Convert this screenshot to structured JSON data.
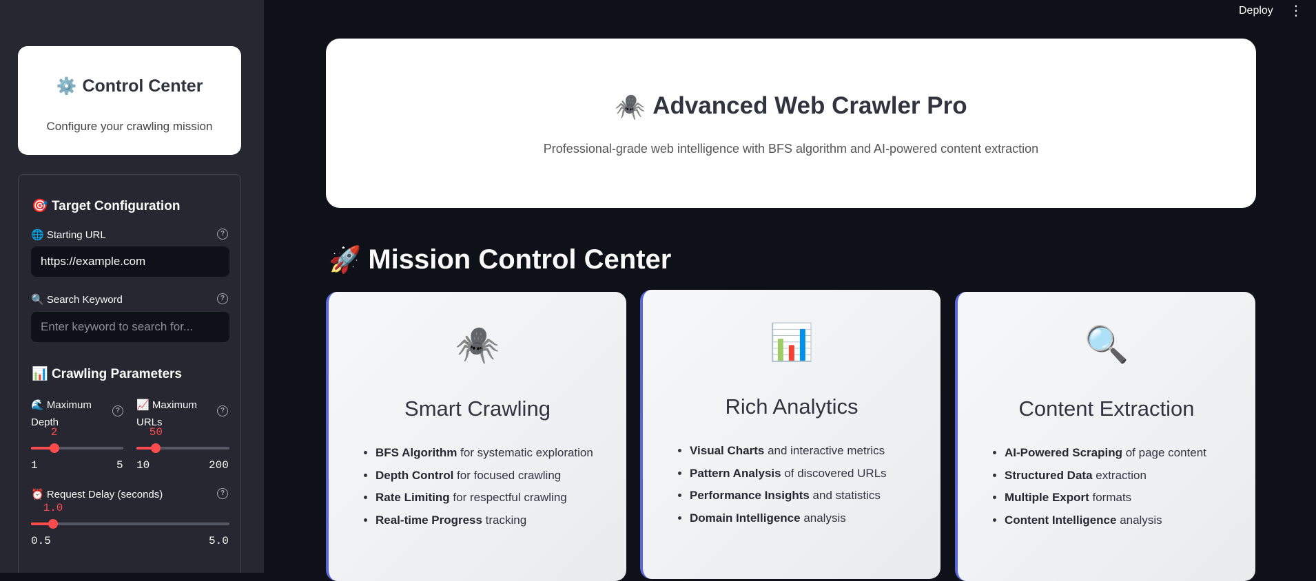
{
  "topbar": {
    "deploy_label": "Deploy",
    "menu_glyph": "⋮"
  },
  "sidebar": {
    "card": {
      "icon": "⚙️",
      "title": "Control Center",
      "subtitle": "Configure your crawling mission"
    },
    "target_section": {
      "icon": "🎯",
      "title": "Target Configuration",
      "url_label": "🌐 Starting URL",
      "url_value": "https://example.com",
      "keyword_label": "🔍 Search Keyword",
      "keyword_placeholder": "Enter keyword to search for..."
    },
    "params_section": {
      "icon": "📊",
      "title": "Crawling Parameters",
      "depth": {
        "label_line1": "🌊 Maximum",
        "label_line2": "Depth",
        "value": "2",
        "numeric": 2,
        "min": "1",
        "max": "5",
        "min_n": 1,
        "max_n": 5
      },
      "urls": {
        "label_line1": "📈 Maximum",
        "label_line2": "URLs",
        "value": "50",
        "numeric": 50,
        "min": "10",
        "max": "200",
        "min_n": 10,
        "max_n": 200
      },
      "delay": {
        "label": "⏰ Request Delay (seconds)",
        "value": "1.0",
        "numeric": 1.0,
        "min": "0.5",
        "max": "5.0",
        "min_n": 0.5,
        "max_n": 5.0
      }
    }
  },
  "hero": {
    "icon": "🕷️",
    "title": "Advanced Web Crawler Pro",
    "subtitle": "Professional-grade web intelligence with BFS algorithm and AI-powered content extraction"
  },
  "mission": {
    "icon": "🚀",
    "title": "Mission Control Center",
    "cards": [
      {
        "icon": "🕷️",
        "title": "Smart Crawling",
        "items": [
          {
            "bold": "BFS Algorithm",
            "rest": " for systematic exploration"
          },
          {
            "bold": "Depth Control",
            "rest": " for focused crawling"
          },
          {
            "bold": "Rate Limiting",
            "rest": " for respectful crawling"
          },
          {
            "bold": "Real-time Progress",
            "rest": " tracking"
          }
        ]
      },
      {
        "icon": "📊",
        "title": "Rich Analytics",
        "items": [
          {
            "bold": "Visual Charts",
            "rest": " and interactive metrics"
          },
          {
            "bold": "Pattern Analysis",
            "rest": " of discovered URLs"
          },
          {
            "bold": "Performance Insights",
            "rest": " and statistics"
          },
          {
            "bold": "Domain Intelligence",
            "rest": " analysis"
          }
        ]
      },
      {
        "icon": "🔍",
        "title": "Content Extraction",
        "items": [
          {
            "bold": "AI-Powered Scraping",
            "rest": " of page content"
          },
          {
            "bold": "Structured Data",
            "rest": " extraction"
          },
          {
            "bold": "Multiple Export",
            "rest": " formats"
          },
          {
            "bold": "Content Intelligence",
            "rest": " analysis"
          }
        ]
      }
    ]
  },
  "colors": {
    "accent": "#ff4b4b",
    "card_border": "#5a67d8",
    "bg": "#0e1117",
    "sidebar_bg": "#262730"
  }
}
